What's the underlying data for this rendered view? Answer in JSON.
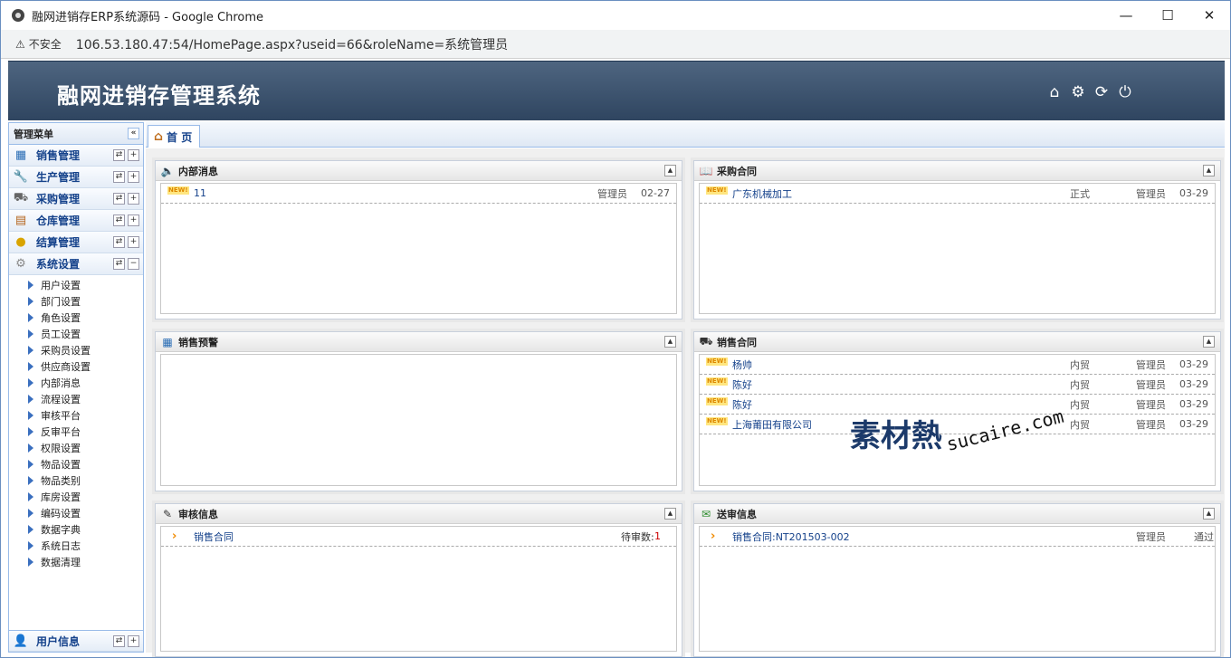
{
  "browser": {
    "title": "融网进销存ERP系统源码 - Google Chrome",
    "security_label": "不安全",
    "url": "106.53.180.47:54/HomePage.aspx?useid=66&roleName=系统管理员"
  },
  "header": {
    "brand": "融网进销存管理系统",
    "icons": [
      "home-icon",
      "gear-icon",
      "refresh-icon",
      "power-icon"
    ]
  },
  "sidebar": {
    "title": "管理菜单",
    "collapse": "«",
    "menu": [
      {
        "label": "销售管理",
        "icon": "sales-icon"
      },
      {
        "label": "生产管理",
        "icon": "wrench-icon"
      },
      {
        "label": "采购管理",
        "icon": "truck-icon"
      },
      {
        "label": "仓库管理",
        "icon": "warehouse-icon"
      },
      {
        "label": "结算管理",
        "icon": "coins-icon"
      },
      {
        "label": "系统设置",
        "icon": "settings-icon"
      }
    ],
    "submenu": [
      "用户设置",
      "部门设置",
      "角色设置",
      "员工设置",
      "采购员设置",
      "供应商设置",
      "内部消息",
      "流程设置",
      "审核平台",
      "反审平台",
      "权限设置",
      "物品设置",
      "物品类别",
      "库房设置",
      "编码设置",
      "数据字典",
      "系统日志",
      "数据清理"
    ],
    "footer": "用户信息"
  },
  "tabs": {
    "home": "首 页"
  },
  "panels": {
    "internal_msg": {
      "title": "内部消息",
      "rows": [
        {
          "text": "11",
          "user": "管理员",
          "date": "02-27"
        }
      ]
    },
    "purchase_contract": {
      "title": "采购合同",
      "rows": [
        {
          "text": "广东机械加工",
          "status": "正式",
          "user": "管理员",
          "date": "03-29"
        }
      ]
    },
    "sales_warning": {
      "title": "销售预警"
    },
    "sales_contract": {
      "title": "销售合同",
      "rows": [
        {
          "text": "杨帅",
          "status": "内贸",
          "user": "管理员",
          "date": "03-29"
        },
        {
          "text": "陈好",
          "status": "内贸",
          "user": "管理员",
          "date": "03-29"
        },
        {
          "text": "陈好",
          "status": "内贸",
          "user": "管理员",
          "date": "03-29"
        },
        {
          "text": "上海莆田有限公司",
          "status": "内贸",
          "user": "管理员",
          "date": "03-29"
        }
      ]
    },
    "audit_info": {
      "title": "审核信息",
      "rows": [
        {
          "text": "销售合同",
          "pending": "待审数:",
          "count": "1"
        }
      ]
    },
    "submit_info": {
      "title": "送审信息",
      "rows": [
        {
          "text": "销售合同:NT201503-002",
          "user": "管理员",
          "result": "通过"
        }
      ]
    }
  },
  "new_badge": "NEW!",
  "watermark": {
    "cn": "素材熱",
    "en": "sucaire.com"
  },
  "colors": {
    "header_top": "#4e6580",
    "header_bottom": "#2f4560",
    "link": "#15428b",
    "accent": "#f08a00"
  }
}
